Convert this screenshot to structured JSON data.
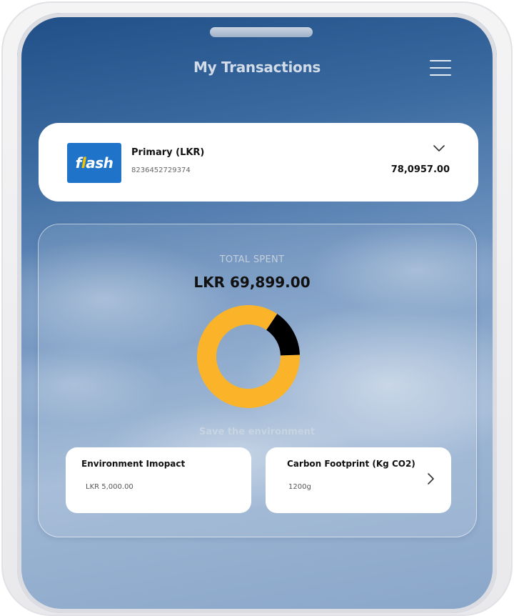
{
  "header": {
    "title": "My Transactions",
    "menu_icon": "hamburger-menu-icon"
  },
  "account": {
    "logo_text_pre": "f",
    "logo_bolt": "l",
    "logo_text_post": "ash",
    "name": "Primary (LKR)",
    "number": "8236452729374",
    "balance": "78,0957.00",
    "dropdown_icon": "chevron-down-icon"
  },
  "summary": {
    "total_label": "TOTAL SPENT",
    "total_amount": "LKR 69,899.00",
    "save_label": "Save the environment"
  },
  "chart_data": {
    "type": "pie",
    "style": "donut",
    "values": [
      85,
      15
    ],
    "colors": [
      "#FBB42A",
      "#000000"
    ]
  },
  "cards": {
    "environment": {
      "title": "Environment Imopact",
      "value": "LKR 5,000.00"
    },
    "carbon": {
      "title": "Carbon Footprint (Kg CO2)",
      "value": "1200g",
      "icon": "chevron-right-icon"
    }
  }
}
